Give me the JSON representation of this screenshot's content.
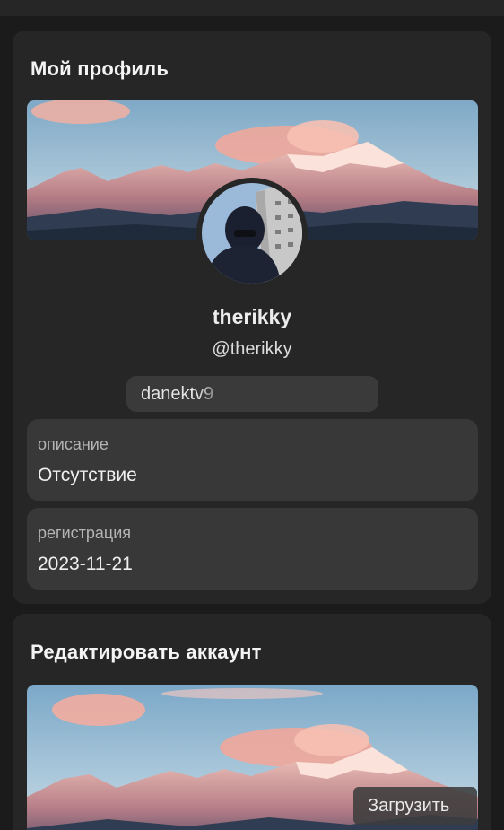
{
  "profile_card": {
    "title": "Мой профиль",
    "display_name": "therikky",
    "username": "@therikky",
    "tag_value": "danektv9",
    "description": {
      "label": "описание",
      "value": "Отсутствие"
    },
    "registration": {
      "label": "регистрация",
      "value": "2023-11-21"
    }
  },
  "edit_card": {
    "title": "Редактировать аккаунт",
    "upload_label": "Загрузить"
  },
  "icons": {
    "avatar": "avatar-image",
    "banner": "mountain-banner-image"
  },
  "colors": {
    "background": "#1b1b1b",
    "card": "#262626",
    "field": "#383838"
  }
}
